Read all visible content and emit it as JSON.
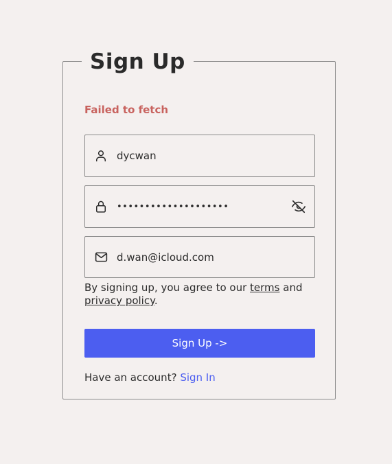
{
  "form": {
    "title": "Sign Up",
    "error": "Failed to fetch",
    "username": {
      "value": "dycwan",
      "icon": "user-icon"
    },
    "password": {
      "value": "••••••••••••••••••••",
      "icon": "lock-icon",
      "toggle_icon": "eye-off-icon"
    },
    "email": {
      "value": "d.wan@icloud.com",
      "icon": "mail-icon"
    },
    "legal": {
      "prefix": "By signing up, you agree to our ",
      "terms": "terms",
      "middle": " and ",
      "privacy": "privacy policy",
      "suffix": "."
    },
    "submit_label": "Sign Up ->",
    "footer": {
      "prompt": "Have an account? ",
      "link": "Sign In"
    }
  },
  "colors": {
    "background": "#f4f0ef",
    "accent": "#4c5ef0",
    "error": "#c8625e",
    "border": "#8a8a8a"
  }
}
